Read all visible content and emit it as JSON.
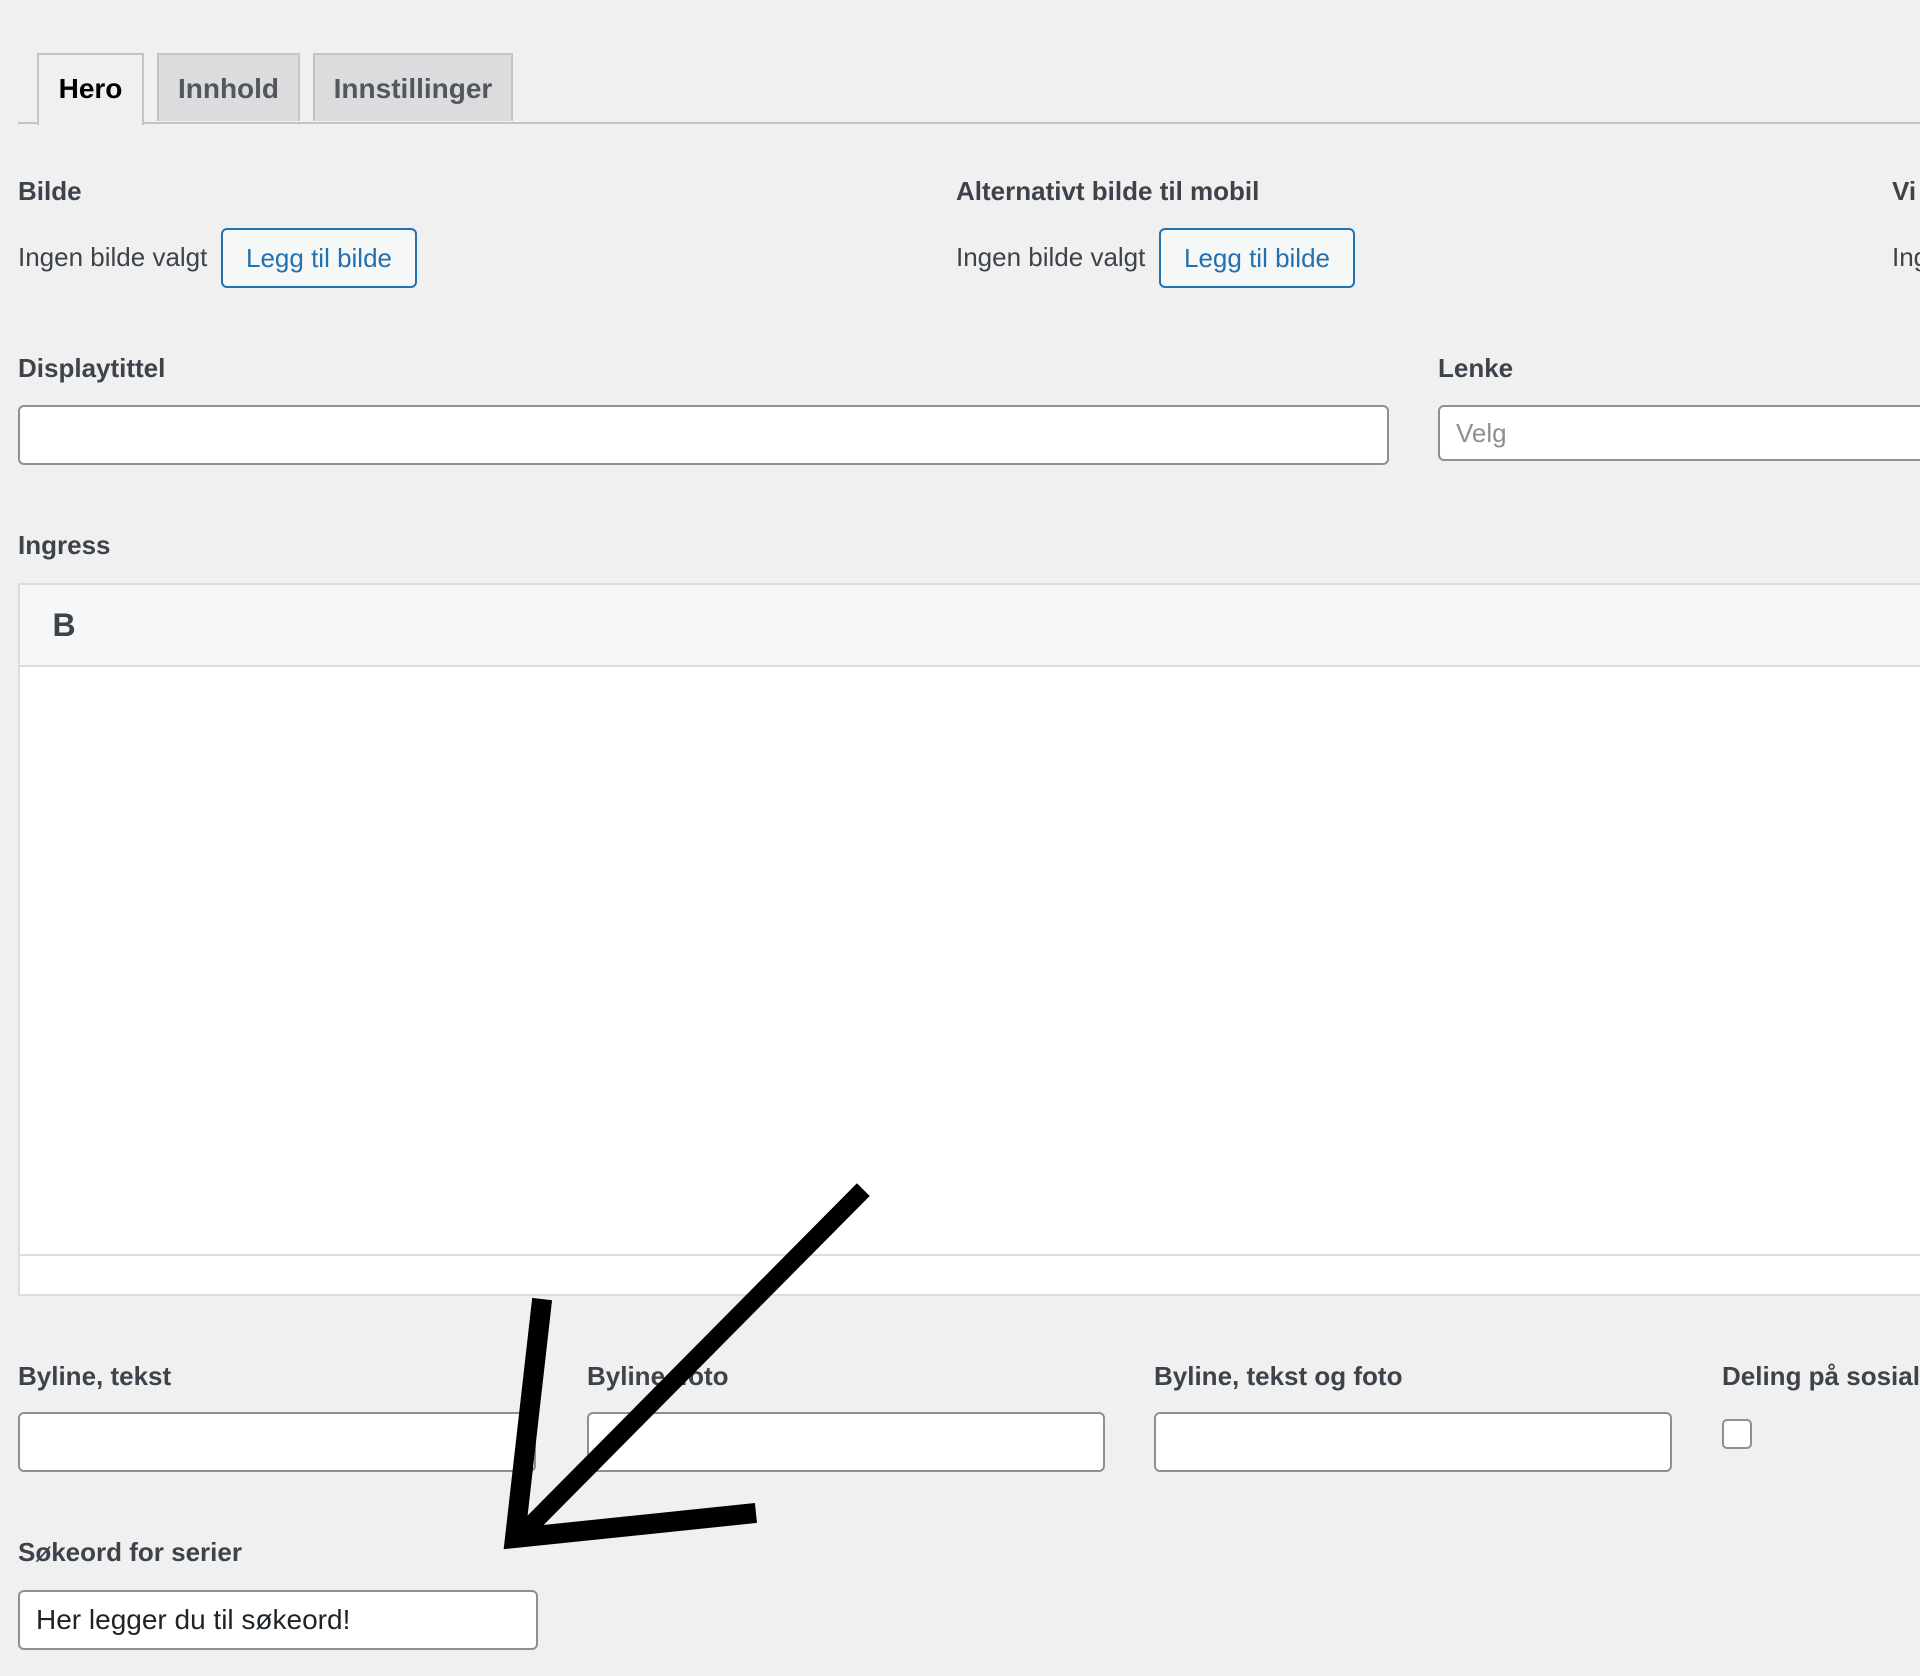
{
  "tabs": [
    {
      "label": "Hero",
      "active": true
    },
    {
      "label": "Innhold",
      "active": false
    },
    {
      "label": "Innstillinger",
      "active": false
    }
  ],
  "image_fields": [
    {
      "label": "Bilde",
      "status": "Ingen bilde valgt",
      "button": "Legg til bilde"
    },
    {
      "label": "Alternativt bilde til mobil",
      "status": "Ingen bilde valgt",
      "button": "Legg til bilde"
    },
    {
      "label": "Vi",
      "status": "Ing"
    }
  ],
  "display_title": {
    "label": "Displaytittel",
    "value": ""
  },
  "link": {
    "label": "Lenke",
    "placeholder": "Velg"
  },
  "ingress": {
    "label": "Ingress",
    "toolbar": {
      "bold": "B"
    }
  },
  "byline": [
    {
      "label": "Byline, tekst",
      "value": ""
    },
    {
      "label": "Byline, foto",
      "value": ""
    },
    {
      "label": "Byline, tekst og foto",
      "value": ""
    }
  ],
  "social_share": {
    "label": "Deling på sosial",
    "checked": false
  },
  "search_keywords": {
    "label": "Søkeord for serier",
    "value": "Her legger du til søkeord!"
  },
  "annotation": {
    "type": "arrow",
    "color": "#000000"
  }
}
